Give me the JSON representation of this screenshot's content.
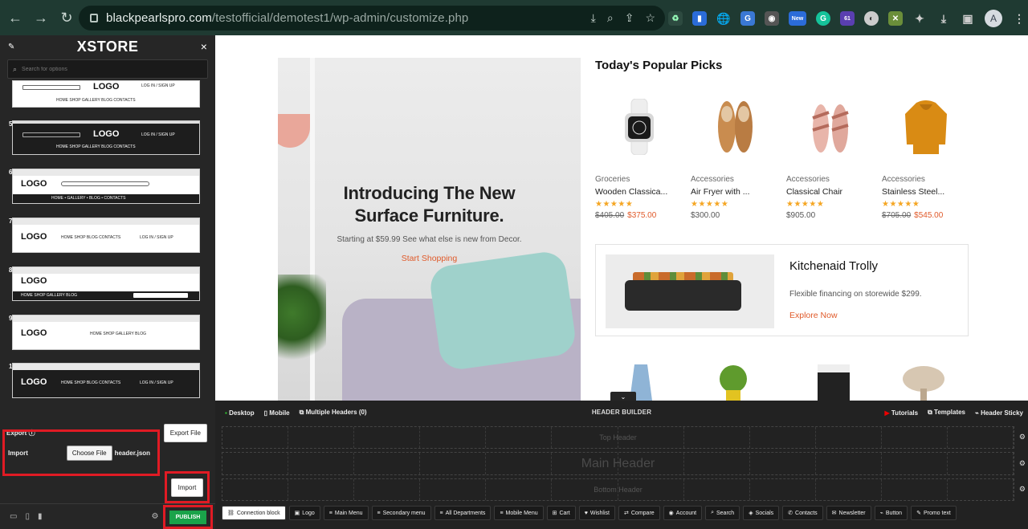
{
  "browser": {
    "url_host": "blackpearlspro.com",
    "url_path": "/testofficial/demotest1/wp-admin/customize.php",
    "ext_badges": [
      "New",
      "61"
    ],
    "avatar": "A"
  },
  "sidebar": {
    "brand": "XSTORE",
    "close": "×",
    "search_placeholder": "Search for options",
    "presets": [
      {
        "num": "",
        "logo": "LOGO",
        "right": "LOG IN / SIGN UP",
        "menu": "HOME   SHOP   GALLERY   BLOG   CONTACTS"
      },
      {
        "num": "5",
        "logo": "LOGO",
        "right": "LOG IN / SIGN UP",
        "menu": "HOME   SHOP   GALLERY   BLOG   CONTACTS"
      },
      {
        "num": "6",
        "logo": "LOGO",
        "right": "",
        "menu": "HOME  •  GALLERY  •  BLOG  •  CONTACTS"
      },
      {
        "num": "7",
        "logo": "LOGO",
        "right": "LOG IN / SIGN UP",
        "menu": "HOME   SHOP   BLOG   CONTACTS"
      },
      {
        "num": "8",
        "logo": "LOGO",
        "right": "",
        "menu": "HOME   SHOP   GALLERY   BLOG"
      },
      {
        "num": "9",
        "logo": "LOGO",
        "right": "",
        "menu": "HOME   SHOP   GALLERY   BLOG"
      },
      {
        "num": "10",
        "logo": "LOGO",
        "right": "LOG IN / SIGN UP",
        "menu": "HOME   SHOP   BLOG   CONTACTS"
      }
    ],
    "export_label": "Export",
    "export_button": "Export File",
    "import_label": "Import",
    "choose_file": "Choose File",
    "file_name": "header.json",
    "import_button": "Import",
    "publish": "PUBLISH"
  },
  "preview": {
    "hero_title_1": "Introducing The New",
    "hero_title_2": "Surface Furniture.",
    "hero_sub": "Starting at $59.99 See what else is new from Decor.",
    "hero_cta": "Start Shopping",
    "popular_title": "Today's Popular Picks",
    "products": [
      {
        "category": "Groceries",
        "name": "Wooden Classica...",
        "old_price": "$405.00",
        "price": "$375.00",
        "rating": 5
      },
      {
        "category": "Accessories",
        "name": "Air Fryer with ...",
        "old_price": "",
        "price": "$300.00",
        "rating": 5
      },
      {
        "category": "Accessories",
        "name": "Classical Chair",
        "old_price": "",
        "price": "$905.00",
        "rating": 5
      },
      {
        "category": "Accessories",
        "name": "Stainless Steel...",
        "old_price": "$705.00",
        "price": "$545.00",
        "rating": 5
      }
    ],
    "promo_title": "Kitchenaid Trolly",
    "promo_sub": "Flexible financing on storewide $299.",
    "promo_cta": "Explore Now"
  },
  "builder": {
    "desktop": "Desktop",
    "mobile": "Mobile",
    "multiple": "Multiple Headers (0)",
    "title": "HEADER BUILDER",
    "tutorials": "Tutorials",
    "templates": "Templates",
    "sticky": "Header Sticky",
    "top_header": "Top Header",
    "main_header": "Main Header",
    "bottom_header": "Bottom Header",
    "elements": [
      "Connection block",
      "Logo",
      "Main Menu",
      "Secondary menu",
      "All Departments",
      "Mobile Menu",
      "Cart",
      "Wishlist",
      "Compare",
      "Account",
      "Search",
      "Socials",
      "Contacts",
      "Newsletter",
      "Button",
      "Promo text"
    ]
  }
}
